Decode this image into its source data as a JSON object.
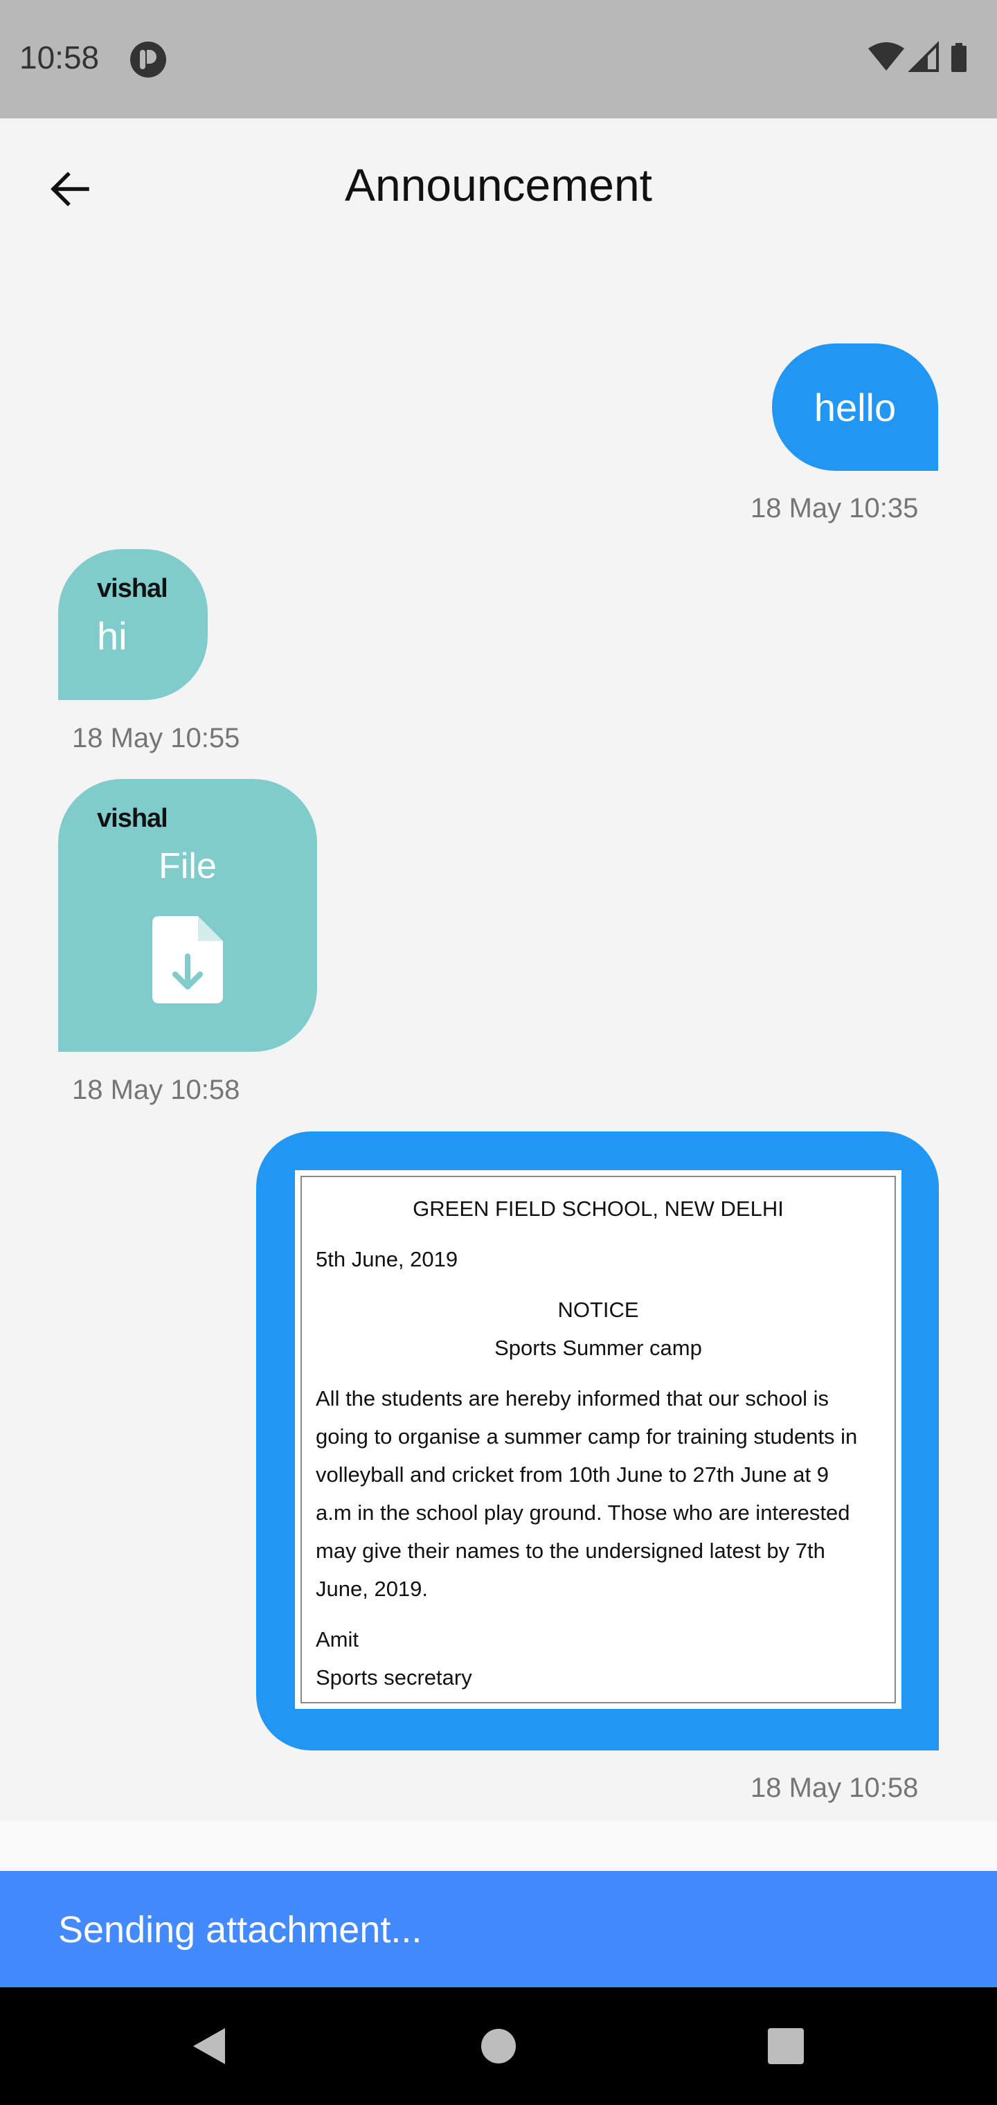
{
  "status_bar": {
    "time": "10:58"
  },
  "header": {
    "title": "Announcement"
  },
  "messages": {
    "m1": {
      "text": "hello",
      "time": "18 May 10:35"
    },
    "m2": {
      "sender": "vishal",
      "text": "hi",
      "time": "18 May 10:55"
    },
    "m3": {
      "sender": "vishal",
      "label": "File",
      "time": "18 May 10:58"
    },
    "m4": {
      "time": "18 May 10:58",
      "notice": {
        "school": "GREEN FIELD SCHOOL, NEW DELHI",
        "date": "5th June, 2019",
        "heading": "NOTICE",
        "subject": "Sports Summer camp",
        "lines": [
          "All the students are hereby informed that our school is",
          "going to organise a summer camp for training students in",
          "volleyball and cricket from 10th June to 27th June at 9",
          "a.m in the school play ground. Those who are interested",
          "may give their names to the undersigned latest by 7th",
          "June, 2019."
        ],
        "signer": "Amit",
        "signer_role": "Sports secretary"
      }
    }
  },
  "snackbar": {
    "text": "Sending attachment..."
  },
  "colors": {
    "outgoing": "#2196f3",
    "incoming": "#80cbcc",
    "snackbar": "#448aff"
  },
  "icons": [
    "app-notification-icon",
    "wifi-icon",
    "cell-signal-icon",
    "battery-icon",
    "back-arrow-icon",
    "file-download-icon",
    "nav-back-icon",
    "nav-home-icon",
    "nav-recents-icon"
  ]
}
